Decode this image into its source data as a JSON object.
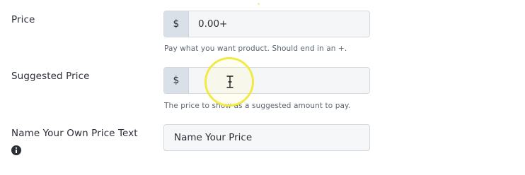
{
  "price": {
    "label": "Price",
    "currency_symbol": "$",
    "value": "0.00+",
    "help": "Pay what you want product. Should end in an +."
  },
  "suggested_price": {
    "label": "Suggested Price",
    "currency_symbol": "$",
    "value": "",
    "help": "The price to show as a suggested amount to pay."
  },
  "name_your_own_price": {
    "label": "Name Your Own Price Text",
    "value": "Name Your Price",
    "info_icon": "info-circle-icon"
  },
  "colors": {
    "addon_bg": "#d9e0e7",
    "input_bg": "#f4f6f8",
    "cursor_highlight": "#f1ea46"
  }
}
